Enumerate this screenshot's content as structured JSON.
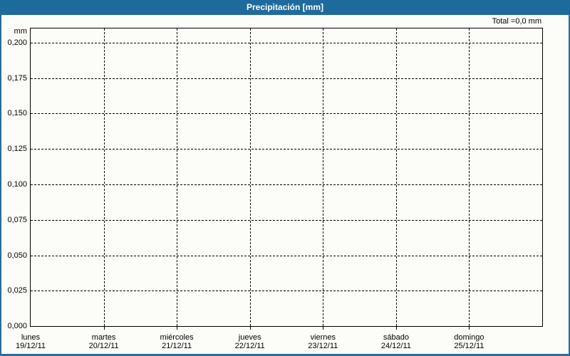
{
  "header": {
    "title": "Precipitación [mm]",
    "total_label": "Total =0,0 mm"
  },
  "colors": {
    "titlebar": "#1f6a9d",
    "frame": "#2b6c9b",
    "background": "#fcfdf8",
    "grid": "#000000",
    "text": "#000000",
    "title_text": "#ffffff"
  },
  "chart_data": {
    "type": "bar",
    "title": "Precipitación [mm]",
    "xlabel": "",
    "ylabel": "mm",
    "total": "Total =0,0 mm",
    "decimal_separator": ",",
    "grid": "dashed-black",
    "legend": "none",
    "ylim": [
      0,
      0.21
    ],
    "categories": [
      {
        "day": "lunes",
        "date": "19/12/11"
      },
      {
        "day": "martes",
        "date": "20/12/11"
      },
      {
        "day": "miércoles",
        "date": "21/12/11"
      },
      {
        "day": "jueves",
        "date": "22/12/11"
      },
      {
        "day": "viernes",
        "date": "23/12/11"
      },
      {
        "day": "sábado",
        "date": "24/12/11"
      },
      {
        "day": "domingo",
        "date": "25/12/11"
      }
    ],
    "series": [
      {
        "name": "Precipitación",
        "values": [
          0,
          0,
          0,
          0,
          0,
          0,
          0
        ]
      }
    ],
    "y_ticks": [
      {
        "label": "0,200",
        "value": 0.2
      },
      {
        "label": "0,175",
        "value": 0.175
      },
      {
        "label": "0,150",
        "value": 0.15
      },
      {
        "label": "0,125",
        "value": 0.125
      },
      {
        "label": "0,100",
        "value": 0.1
      },
      {
        "label": "0,075",
        "value": 0.075
      },
      {
        "label": "0,050",
        "value": 0.05
      },
      {
        "label": "0,025",
        "value": 0.025
      },
      {
        "label": "0,000",
        "value": 0.0
      }
    ]
  }
}
